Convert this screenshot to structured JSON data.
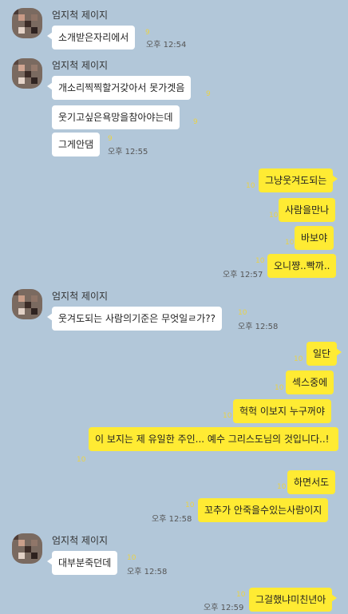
{
  "contact": {
    "name": "엄지척 제이지"
  },
  "messages": [
    {
      "text": "소개받은자리에서",
      "unread": "9",
      "time": "오후 12:54"
    },
    {
      "text": "개소리찍찍할거갖아서 못가겟음",
      "unread": "9",
      "time": ""
    },
    {
      "text": "웃기고싶은욕망을참아야는데",
      "unread": "9",
      "time": ""
    },
    {
      "text": "그게안댐",
      "unread": "9",
      "time": "오후 12:55"
    },
    {
      "text": "그냥웃겨도되는",
      "unread": "10",
      "time": ""
    },
    {
      "text": "사람을만나",
      "unread": "10",
      "time": ""
    },
    {
      "text": "바보야",
      "unread": "10",
      "time": ""
    },
    {
      "text": "오니쨩..빡까..",
      "unread": "10",
      "time": "오후 12:57"
    },
    {
      "text": "웃겨도되는 사람의기준은 무엇일ㄹ가??",
      "unread": "10",
      "time": "오후 12:58"
    },
    {
      "text": "일단",
      "unread": "10",
      "time": ""
    },
    {
      "text": "섹스중에",
      "unread": "10",
      "time": ""
    },
    {
      "text": "헉헉 이보지 누구꺼야",
      "unread": "10",
      "time": ""
    },
    {
      "text": "이 보지는 제 유일한 주인... 예수 그리스도님의 것입니다..!",
      "unread": "10",
      "time": ""
    },
    {
      "text": "하면서도",
      "unread": "10",
      "time": ""
    },
    {
      "text": "꼬추가 안죽을수있는사람이지",
      "unread": "10",
      "time": "오후 12:58"
    },
    {
      "text": "대부분죽던데",
      "unread": "10",
      "time": "오후 12:58"
    },
    {
      "text": "그걸했냐미친년아",
      "unread": "10",
      "time": "오후 12:59"
    }
  ]
}
